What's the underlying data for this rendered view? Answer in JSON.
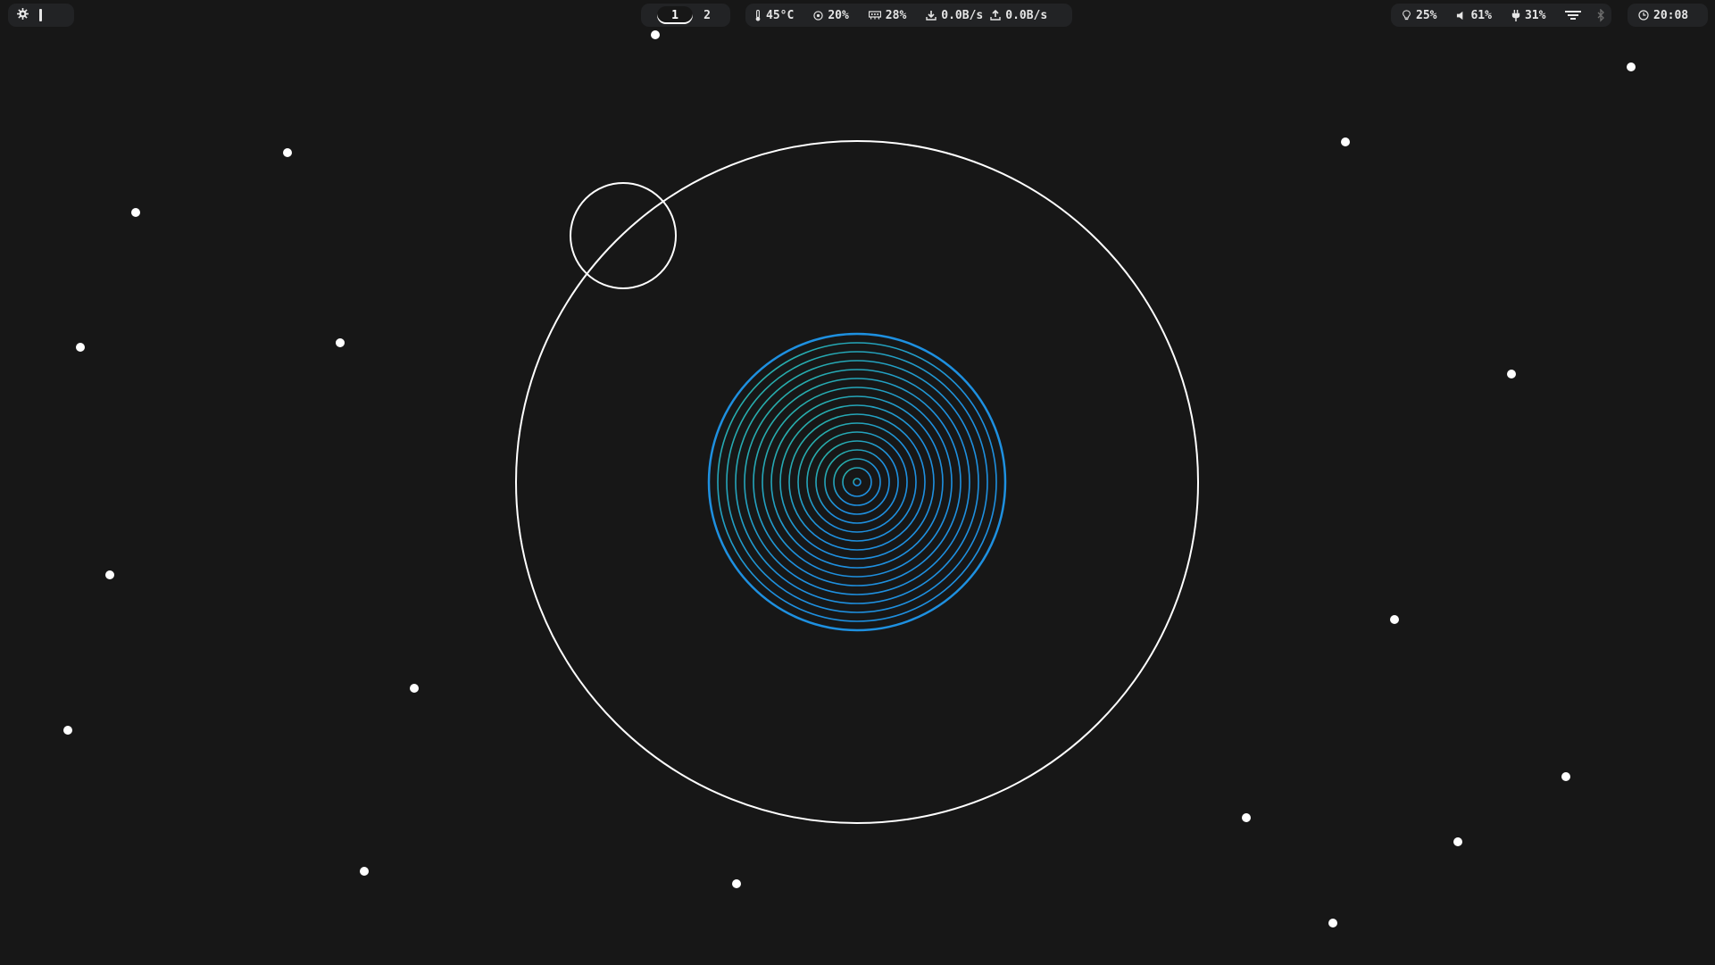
{
  "bar": {
    "left": {
      "launcher_icon": "gear-icon"
    },
    "workspaces": [
      {
        "label": "1",
        "active": true
      },
      {
        "label": "2",
        "active": false
      }
    ],
    "system": {
      "temperature": "45°C",
      "cpu": "20%",
      "memory": "28%",
      "download": "0.0B/s",
      "upload": "0.0B/s"
    },
    "status": {
      "brightness": "25%",
      "volume": "61%",
      "battery": "31%",
      "wifi_icon": "wifi-icon",
      "bluetooth_icon": "bluetooth-icon"
    },
    "clock": {
      "time": "20:08"
    }
  },
  "colors": {
    "background": "#171717",
    "bar_pill": "#222325",
    "text": "#e6e6e6",
    "ring_blue": "#1e90e0",
    "ring_teal": "#2ab89a",
    "star": "#ffffff"
  }
}
